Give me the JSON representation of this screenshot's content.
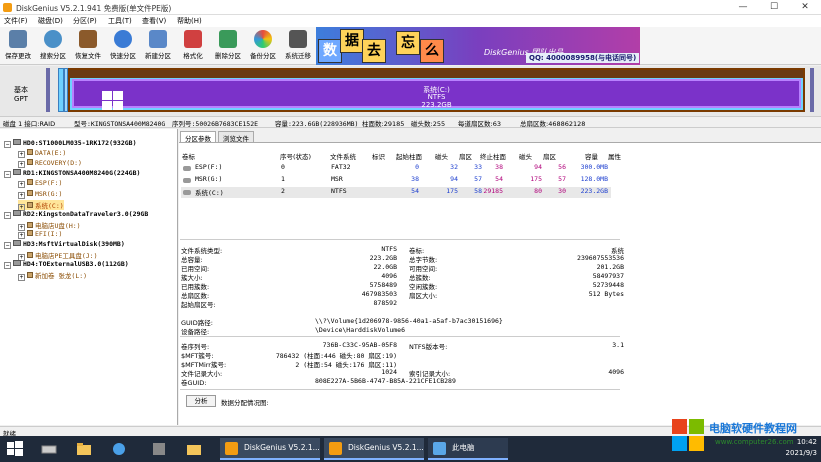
{
  "titlebar": {
    "title": "DiskGenius V5.2.1.941 免费版(单文件PE版)",
    "min": "—",
    "max": "☐",
    "close": "✕"
  },
  "menu": [
    "文件(F)",
    "磁盘(D)",
    "分区(P)",
    "工具(T)",
    "查看(V)",
    "帮助(H)"
  ],
  "toolbar": [
    "保存更改",
    "搜索分区",
    "恢复文件",
    "快速分区",
    "新建分区",
    "格式化",
    "删除分区",
    "备份分区",
    "系统迁移"
  ],
  "ad": {
    "blocks": [
      "数",
      "据",
      "去",
      "忘",
      "么"
    ],
    "brand": "DiskGenius 团队出品",
    "qq": "QQ: 4000089958(与电话同号)"
  },
  "disk_map": {
    "label_top": "基本",
    "label_bottom": "GPT",
    "part_name": "系统(C:)",
    "part_fs": "NTFS",
    "part_size": "223.2GB"
  },
  "disk_info": {
    "disk": "磁盘 1 接口:RAID",
    "model": "型号:KINGSTONSA400M8240G",
    "serial": "序列号:50026B7683CE152E",
    "capacity": "容量:223.6GB(228936MB)",
    "cylinders": "柱面数:29185",
    "heads": "磁头数:255",
    "sectors_per_track": "每道扇区数:63",
    "total_sectors": "总扇区数:468862128"
  },
  "tree": [
    {
      "t": "HD0:ST1000LM035-1RK172(932GB)",
      "lvl": 0,
      "k": "disk"
    },
    {
      "t": "DATA(E:)",
      "lvl": 1,
      "k": "part"
    },
    {
      "t": "RECOVERY(D:)",
      "lvl": 1,
      "k": "part"
    },
    {
      "t": "RD1:KINGSTONSA400M8240G(224GB)",
      "lvl": 0,
      "k": "disk"
    },
    {
      "t": "ESP(F:)",
      "lvl": 1,
      "k": "part"
    },
    {
      "t": "MSR(G:)",
      "lvl": 1,
      "k": "part"
    },
    {
      "t": "系统(C:)",
      "lvl": 1,
      "k": "part",
      "sel": true
    },
    {
      "t": "RD2:KingstonDataTraveler3.0(29GB",
      "lvl": 0,
      "k": "disk"
    },
    {
      "t": "电脑店U盘(H:)",
      "lvl": 1,
      "k": "part"
    },
    {
      "t": "EFI(I:)",
      "lvl": 1,
      "k": "part"
    },
    {
      "t": "HD3:MsftVirtualDisk(390MB)",
      "lvl": 0,
      "k": "disk"
    },
    {
      "t": "电脑店PE工具盘(J:)",
      "lvl": 1,
      "k": "part"
    },
    {
      "t": "HD4:TOExternalUSB3.0(112GB)",
      "lvl": 0,
      "k": "disk"
    },
    {
      "t": "新加卷 张龙(L:)",
      "lvl": 1,
      "k": "part"
    }
  ],
  "tabs": [
    "分区参数",
    "浏览文件"
  ],
  "table": {
    "headers": [
      "卷标",
      "序号(状态)",
      "文件系统",
      "标识",
      "起始柱面",
      "磁头",
      "扇区",
      "终止柱面",
      "磁头",
      "扇区",
      "容量",
      "属性"
    ],
    "rows": [
      [
        "ESP(F:)",
        "0",
        "FAT32",
        "",
        "0",
        "32",
        "33",
        "38",
        "94",
        "56",
        "300.0MB",
        ""
      ],
      [
        "MSR(G:)",
        "1",
        "MSR",
        "",
        "38",
        "94",
        "57",
        "54",
        "175",
        "57",
        "128.0MB",
        ""
      ],
      [
        "系统(C:)",
        "2",
        "NTFS",
        "",
        "54",
        "175",
        "58",
        "29185",
        "80",
        "30",
        "223.2GB",
        ""
      ]
    ]
  },
  "fs": {
    "left": [
      [
        "文件系统类型:",
        "NTFS"
      ],
      [
        "总容量:",
        "223.2GB"
      ],
      [
        "已用空间:",
        "22.0GB"
      ],
      [
        "簇大小:",
        "4096"
      ],
      [
        "已用簇数:",
        "5758489"
      ],
      [
        "总扇区数:",
        "467983503"
      ],
      [
        "起始扇区号:",
        "878592"
      ]
    ],
    "right": [
      [
        "卷标:",
        "系统"
      ],
      [
        "总字节数:",
        "239607553536"
      ],
      [
        "可用空间:",
        "201.2GB"
      ],
      [
        "总簇数:",
        "58497937"
      ],
      [
        "空闲簇数:",
        "52739448"
      ],
      [
        "扇区大小:",
        "512 Bytes"
      ]
    ],
    "guid_label": "GUID路径:",
    "guid_value": "\\\\?\\Volume{1d206978-9856-40a1-a5af-b7ac30151696}",
    "dev_label": "设备路径:",
    "dev_value": "\\Device\\HarddiskVolume6"
  },
  "ntfs": {
    "left": [
      [
        "卷序列号:",
        "736B-C33C-95AB-05F8"
      ],
      [
        "$MFT簇号:",
        "786432 (柱面:446 磁头:80 扇区:19)"
      ],
      [
        "$MFTMirr簇号:",
        "2 (柱面:54 磁头:176 扇区:11)"
      ],
      [
        "文件记录大小:",
        "1024"
      ],
      [
        "卷GUID:",
        "808E227A-5B6B-4747-B85A-221CFE1CB289"
      ]
    ],
    "right": [
      [
        "NTFS版本号:",
        "3.1"
      ],
      [
        "",
        ""
      ],
      [
        "",
        ""
      ],
      [
        "索引记录大小:",
        "4096"
      ]
    ]
  },
  "analyze": {
    "button": "分析",
    "label": "数据分配情况图:"
  },
  "status": "就绪",
  "taskbar": {
    "task1": "DiskGenius V5.2.1...",
    "task2": "DiskGenius V5.2.1...",
    "task3": "此电脑",
    "time": "10:42",
    "date": "2021/9/3"
  },
  "watermark": {
    "title": "电脑软硬件教程网",
    "url": "www.computer26.com"
  }
}
